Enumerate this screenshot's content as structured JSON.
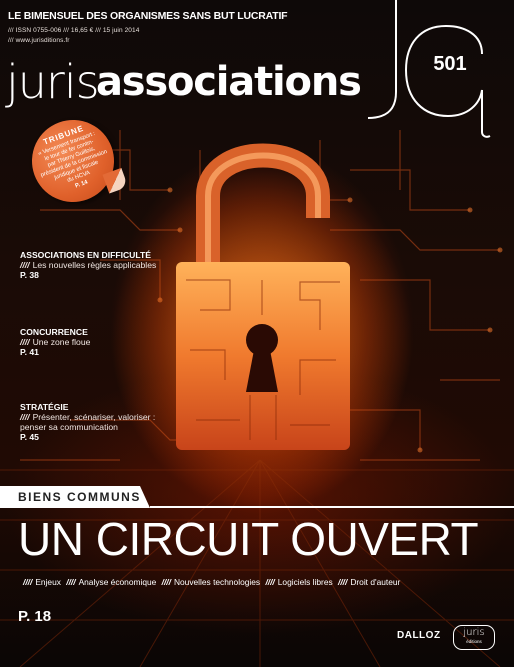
{
  "masthead": {
    "tagline": "LE BIMENSUEL DES ORGANISMES SANS BUT LUCRATIF",
    "meta_line1": "/// ISSN 0755-006 /// 16,65 € /// 15 juin 2014",
    "meta_line2": "/// www.jurisditions.fr",
    "brand_part1": "juris",
    "brand_part2": "associations",
    "issue_number": "501"
  },
  "sticker": {
    "title": "TRIBUNE",
    "lines": [
      "« Versement transport :",
      "le tour de fer contin-",
      "par Thierry Guillois,",
      "président de la commission",
      "juridique et fiscale",
      "du HCVA",
      "P. 14"
    ]
  },
  "sections": [
    {
      "heading": "ASSOCIATIONS EN DIFFICULTÉ",
      "marker": "////",
      "subtitle": "Les nouvelles règles applicables",
      "page": "P. 38"
    },
    {
      "heading": "CONCURRENCE",
      "marker": "////",
      "subtitle": "Une zone floue",
      "page": "P. 41"
    },
    {
      "heading": "STRATÉGIE",
      "marker": "////",
      "subtitle": "Présenter, scénariser, valoriser : penser sa communication",
      "page": "P. 45"
    }
  ],
  "banner": {
    "label": "BIENS COMMUNS"
  },
  "headline": "UN CIRCUIT OUVERT",
  "topics": {
    "separator": "////",
    "items": [
      "Enjeux",
      "Analyse économique",
      "Nouvelles technologies",
      "Logiciels libres",
      "Droit d'auteur"
    ]
  },
  "cover_page_ref": "P. 18",
  "publishers": {
    "primary": "DALLOZ",
    "secondary_name": "juris",
    "secondary_sub": "éditions"
  },
  "colors": {
    "accent_orange": "#e0612b",
    "glow": "#ff7a1a",
    "lock_body": "#f07a2e",
    "background": "#0b0706"
  }
}
